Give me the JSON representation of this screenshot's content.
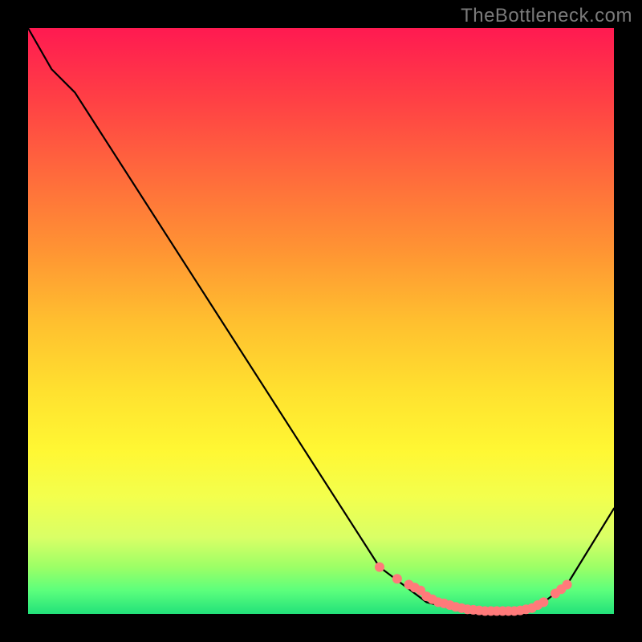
{
  "watermark": "TheBottleneck.com",
  "chart_data": {
    "type": "line",
    "title": "",
    "xlabel": "",
    "ylabel": "",
    "xlim": [
      0,
      100
    ],
    "ylim": [
      0,
      100
    ],
    "grid": false,
    "series": [
      {
        "name": "bottleneck-curve",
        "x": [
          0,
          4,
          8,
          60,
          68,
          72,
          76,
          80,
          84,
          88,
          92,
          100
        ],
        "y": [
          100,
          93,
          89,
          8,
          2,
          1,
          0.5,
          0.5,
          0.6,
          2,
          5,
          18
        ]
      }
    ],
    "markers": {
      "name": "threshold-dots",
      "color": "#ff7a7a",
      "radius": 6,
      "x": [
        60,
        63,
        65,
        66,
        67,
        68,
        69,
        70,
        71,
        72,
        73,
        74,
        75,
        76,
        77,
        78,
        79,
        80,
        81,
        82,
        83,
        84,
        85,
        86,
        87,
        88,
        90,
        91,
        92
      ],
      "y": [
        8,
        6,
        5,
        4.5,
        4,
        3,
        2.5,
        2,
        1.8,
        1.5,
        1.2,
        1,
        0.8,
        0.7,
        0.6,
        0.5,
        0.5,
        0.5,
        0.5,
        0.5,
        0.5,
        0.6,
        0.8,
        1,
        1.5,
        2,
        3.5,
        4.2,
        5
      ]
    },
    "background": {
      "type": "vertical-gradient",
      "stops": [
        {
          "pos": 0,
          "color": "#ff1a51"
        },
        {
          "pos": 25,
          "color": "#ff6a3c"
        },
        {
          "pos": 50,
          "color": "#ffbf2f"
        },
        {
          "pos": 72,
          "color": "#fff733"
        },
        {
          "pos": 92,
          "color": "#9cff66"
        },
        {
          "pos": 100,
          "color": "#22e27a"
        }
      ]
    }
  }
}
